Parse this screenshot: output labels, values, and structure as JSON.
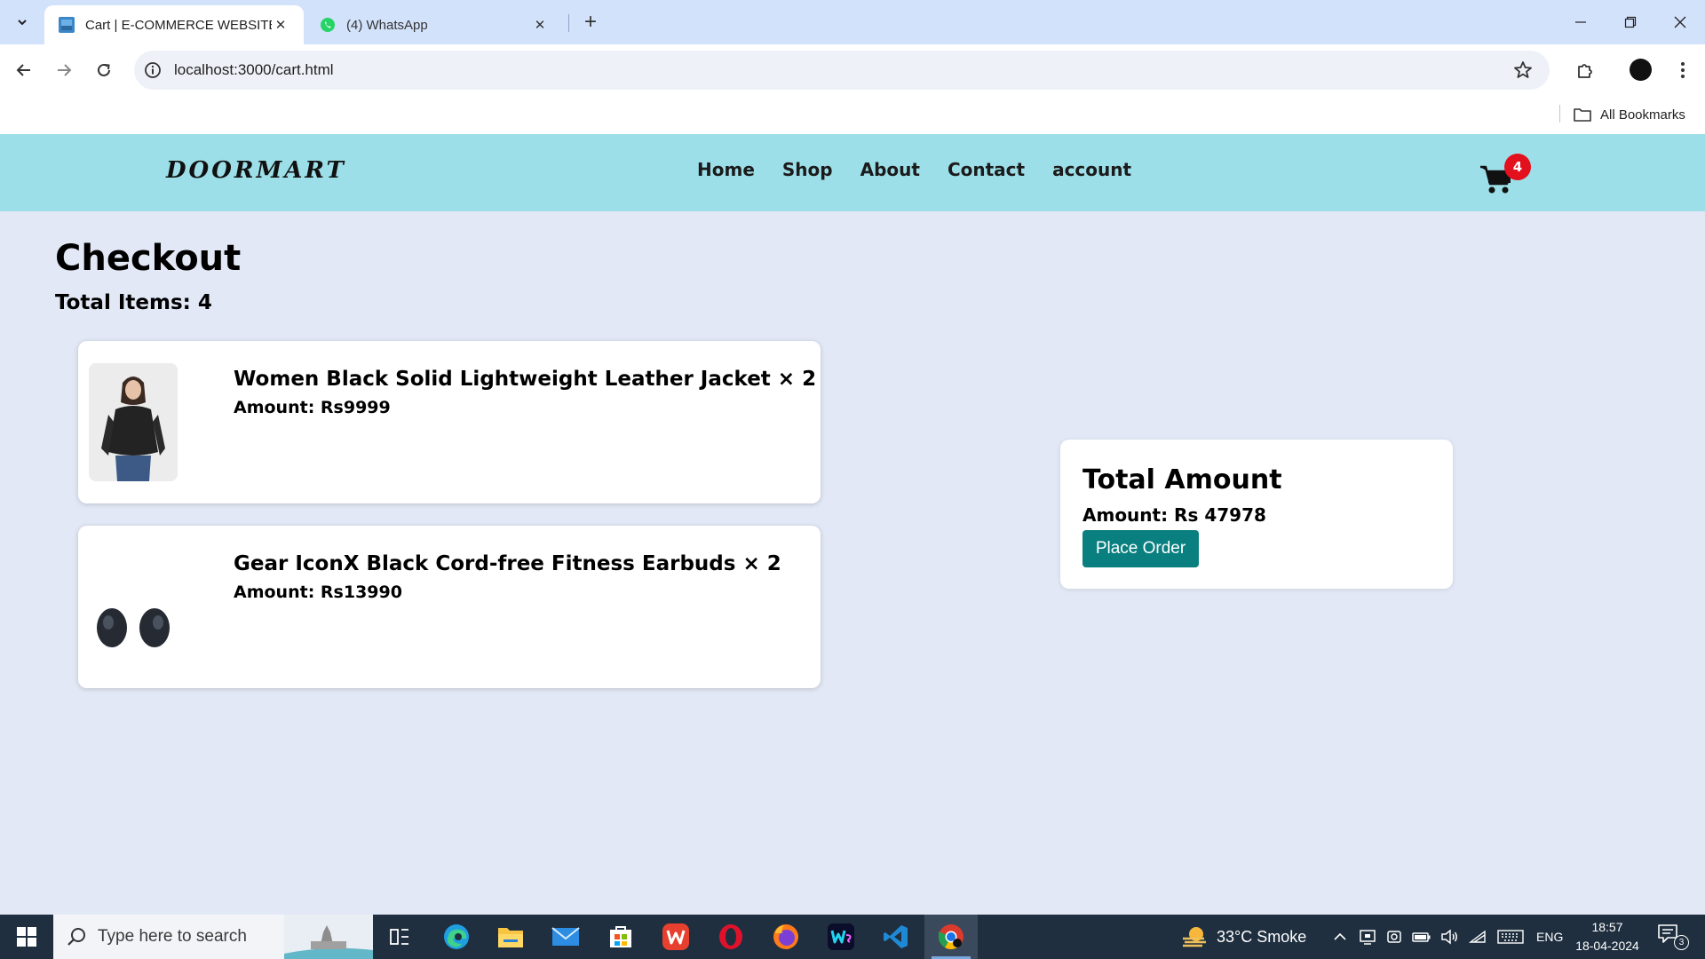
{
  "browser": {
    "tabs": [
      {
        "title": "Cart | E-COMMERCE WEBSITE",
        "active": true
      },
      {
        "title": "(4) WhatsApp",
        "active": false
      }
    ],
    "url": "localhost:3000/cart.html",
    "bookmarks_label": "All Bookmarks"
  },
  "site": {
    "logo": "DOORMART",
    "nav": [
      "Home",
      "Shop",
      "About",
      "Contact",
      "account"
    ],
    "cart_count": "4",
    "colors": {
      "header_bg": "#9ddfe9",
      "page_bg": "#e3e8f6",
      "badge": "#e3101d",
      "button": "#0a7f7f"
    }
  },
  "checkout": {
    "title": "Checkout",
    "total_items": "Total Items: 4",
    "items": [
      {
        "name": "Women Black Solid Lightweight Leather Jacket × 2",
        "amount": "Amount: Rs9999",
        "image_icon": "leather-jacket-photo"
      },
      {
        "name": "Gear IconX Black Cord-free Fitness Earbuds × 2",
        "amount": "Amount: Rs13990",
        "image_icon": "earbuds-photo"
      }
    ],
    "summary": {
      "title": "Total Amount",
      "amount": "Amount: Rs 47978",
      "button": "Place Order"
    }
  },
  "taskbar": {
    "search_placeholder": "Type here to search",
    "weather": "33°C  Smoke",
    "language": "ENG",
    "time": "18:57",
    "date": "18-04-2024",
    "notification_count": "3"
  }
}
